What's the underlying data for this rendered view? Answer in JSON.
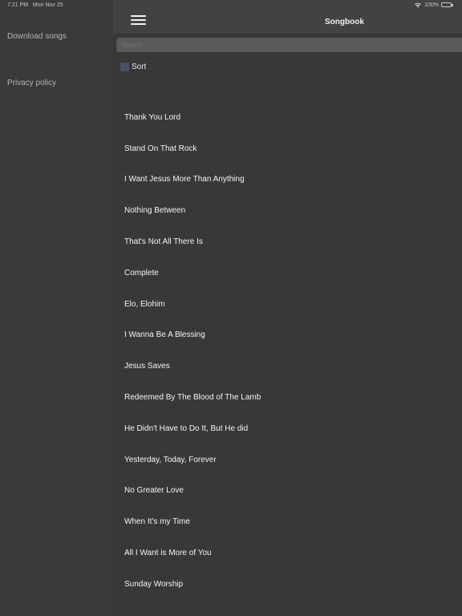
{
  "status_bar": {
    "time": "7:21 PM",
    "date": "Mon Nov 25",
    "battery_percent": "100%",
    "battery_level": 1.0,
    "icons": {
      "wifi": "wifi-icon",
      "battery": "battery-icon"
    }
  },
  "sidebar": {
    "items": [
      {
        "label": "Download songs"
      },
      {
        "label": "Privacy policy"
      }
    ]
  },
  "nav": {
    "title": "Songbook",
    "menu_icon": "hamburger-menu-icon"
  },
  "search": {
    "placeholder": "Search",
    "value": ""
  },
  "sort": {
    "label": "Sort",
    "icon_color": "#4a5068"
  },
  "songs": [
    "Thank You Lord",
    "Stand On That Rock",
    "I Want Jesus More Than Anything",
    "Nothing Between",
    "That's Not All There Is",
    "Complete",
    "Elo, Elohim",
    "I Wanna Be A Blessing",
    "Jesus Saves",
    "Redeemed By The Blood of The Lamb",
    "He Didn't Have to Do It, But He did",
    "Yesterday, Today, Forever",
    "No Greater Love",
    "When It's my Time",
    "All I Want is More of You",
    "Sunday Worship"
  ],
  "colors": {
    "sidebar_background": "#3a3a3a",
    "content_background": "#383838",
    "nav_background": "#424242",
    "search_background": "#5a5a5a",
    "text_primary": "#f4f4f4",
    "text_secondary": "#b4b4b4"
  }
}
